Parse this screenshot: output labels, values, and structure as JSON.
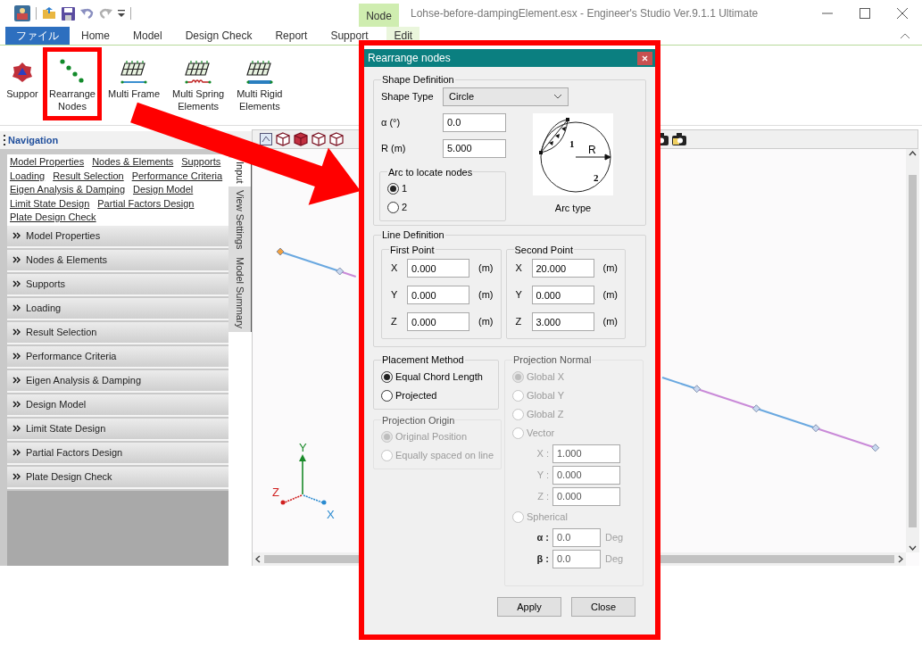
{
  "window": {
    "title": "Lohse-before-dampingElement.esx - Engineer's Studio Ver.9.1.1 Ultimate",
    "context_tab": "Node"
  },
  "menu_tabs": [
    {
      "label": "ファイル",
      "kind": "file"
    },
    {
      "label": "Home",
      "kind": "normal"
    },
    {
      "label": "Model",
      "kind": "normal"
    },
    {
      "label": "Design Check",
      "kind": "normal"
    },
    {
      "label": "Report",
      "kind": "normal"
    },
    {
      "label": "Support",
      "kind": "normal"
    },
    {
      "label": "Edit",
      "kind": "context"
    }
  ],
  "ribbon": [
    {
      "lines": [
        "Suppor"
      ],
      "kind": "support",
      "highlighted": false
    },
    {
      "lines": [
        "Rearrange",
        "Nodes"
      ],
      "kind": "nodes",
      "highlighted": true
    },
    {
      "lines": [
        "Multi Frame"
      ],
      "kind": "frame",
      "highlighted": false
    },
    {
      "lines": [
        "Multi Spring",
        "Elements"
      ],
      "kind": "spring",
      "highlighted": false
    },
    {
      "lines": [
        "Multi Rigid",
        "Elements"
      ],
      "kind": "rigid",
      "highlighted": false
    }
  ],
  "navigation": {
    "title": "Navigation",
    "links": [
      "Model Properties",
      "Nodes & Elements",
      "Supports",
      "Loading",
      "Result Selection",
      "Performance Criteria",
      "Eigen Analysis & Damping",
      "Design Model",
      "Limit State Design",
      "Partial Factors Design",
      "Plate Design Check"
    ],
    "sections": [
      "Model Properties",
      "Nodes & Elements",
      "Supports",
      "Loading",
      "Result Selection",
      "Performance Criteria",
      "Eigen Analysis & Damping",
      "Design Model",
      "Limit State Design",
      "Partial Factors Design",
      "Plate Design Check"
    ],
    "side_tabs": [
      {
        "label": "Input",
        "selected": true
      },
      {
        "label": "View Settings",
        "selected": false
      },
      {
        "label": "Model Summary",
        "selected": false
      }
    ]
  },
  "viewport": {
    "axes": {
      "x": "X",
      "y": "Y",
      "z": "Z"
    }
  },
  "dialog": {
    "title": "Rearrange nodes",
    "shape_definition": {
      "legend": "Shape Definition",
      "shape_type_label": "Shape Type",
      "shape_type_value": "Circle",
      "alpha_label": "α (°)",
      "alpha_value": "0.0",
      "r_label": "R (m)",
      "r_value": "5.000",
      "arc_group": {
        "legend": "Arc to locate nodes",
        "options": [
          {
            "label": "1",
            "selected": true
          },
          {
            "label": "2",
            "selected": false
          }
        ]
      },
      "diagram_labels": [
        "1",
        "2",
        "R"
      ],
      "diagram_caption": "Arc type"
    },
    "line_definition": {
      "legend": "Line Definition",
      "points": [
        {
          "legend": "First Point",
          "rows": [
            {
              "axis": "X",
              "value": "0.000",
              "unit": "(m)"
            },
            {
              "axis": "Y",
              "value": "0.000",
              "unit": "(m)"
            },
            {
              "axis": "Z",
              "value": "0.000",
              "unit": "(m)"
            }
          ]
        },
        {
          "legend": "Second Point",
          "rows": [
            {
              "axis": "X",
              "value": "20.000",
              "unit": "(m)"
            },
            {
              "axis": "Y",
              "value": "0.000",
              "unit": "(m)"
            },
            {
              "axis": "Z",
              "value": "3.000",
              "unit": "(m)"
            }
          ]
        }
      ]
    },
    "placement": {
      "legend": "Placement Method",
      "options": [
        {
          "label": "Equal Chord Length",
          "selected": true
        },
        {
          "label": "Projected",
          "selected": false
        }
      ]
    },
    "projection_origin": {
      "legend": "Projection Origin",
      "disabled": true,
      "options": [
        {
          "label": "Original Position",
          "selected": true
        },
        {
          "label": "Equally spaced on line",
          "selected": false
        }
      ]
    },
    "projection_normal": {
      "legend": "Projection Normal",
      "disabled": true,
      "options": [
        {
          "label": "Global X",
          "selected": true
        },
        {
          "label": "Global Y",
          "selected": false
        },
        {
          "label": "Global Z",
          "selected": false
        },
        {
          "label": "Vector",
          "selected": false,
          "fields": [
            {
              "label": "X :",
              "value": "1.000"
            },
            {
              "label": "Y :",
              "value": "0.000"
            },
            {
              "label": "Z :",
              "value": "0.000"
            }
          ]
        },
        {
          "label": "Spherical",
          "selected": false,
          "fields": [
            {
              "label": "α :",
              "value": "0.0",
              "unit": "Deg"
            },
            {
              "label": "β :",
              "value": "0.0",
              "unit": "Deg"
            }
          ]
        }
      ]
    },
    "buttons": [
      "Apply",
      "Close"
    ]
  }
}
